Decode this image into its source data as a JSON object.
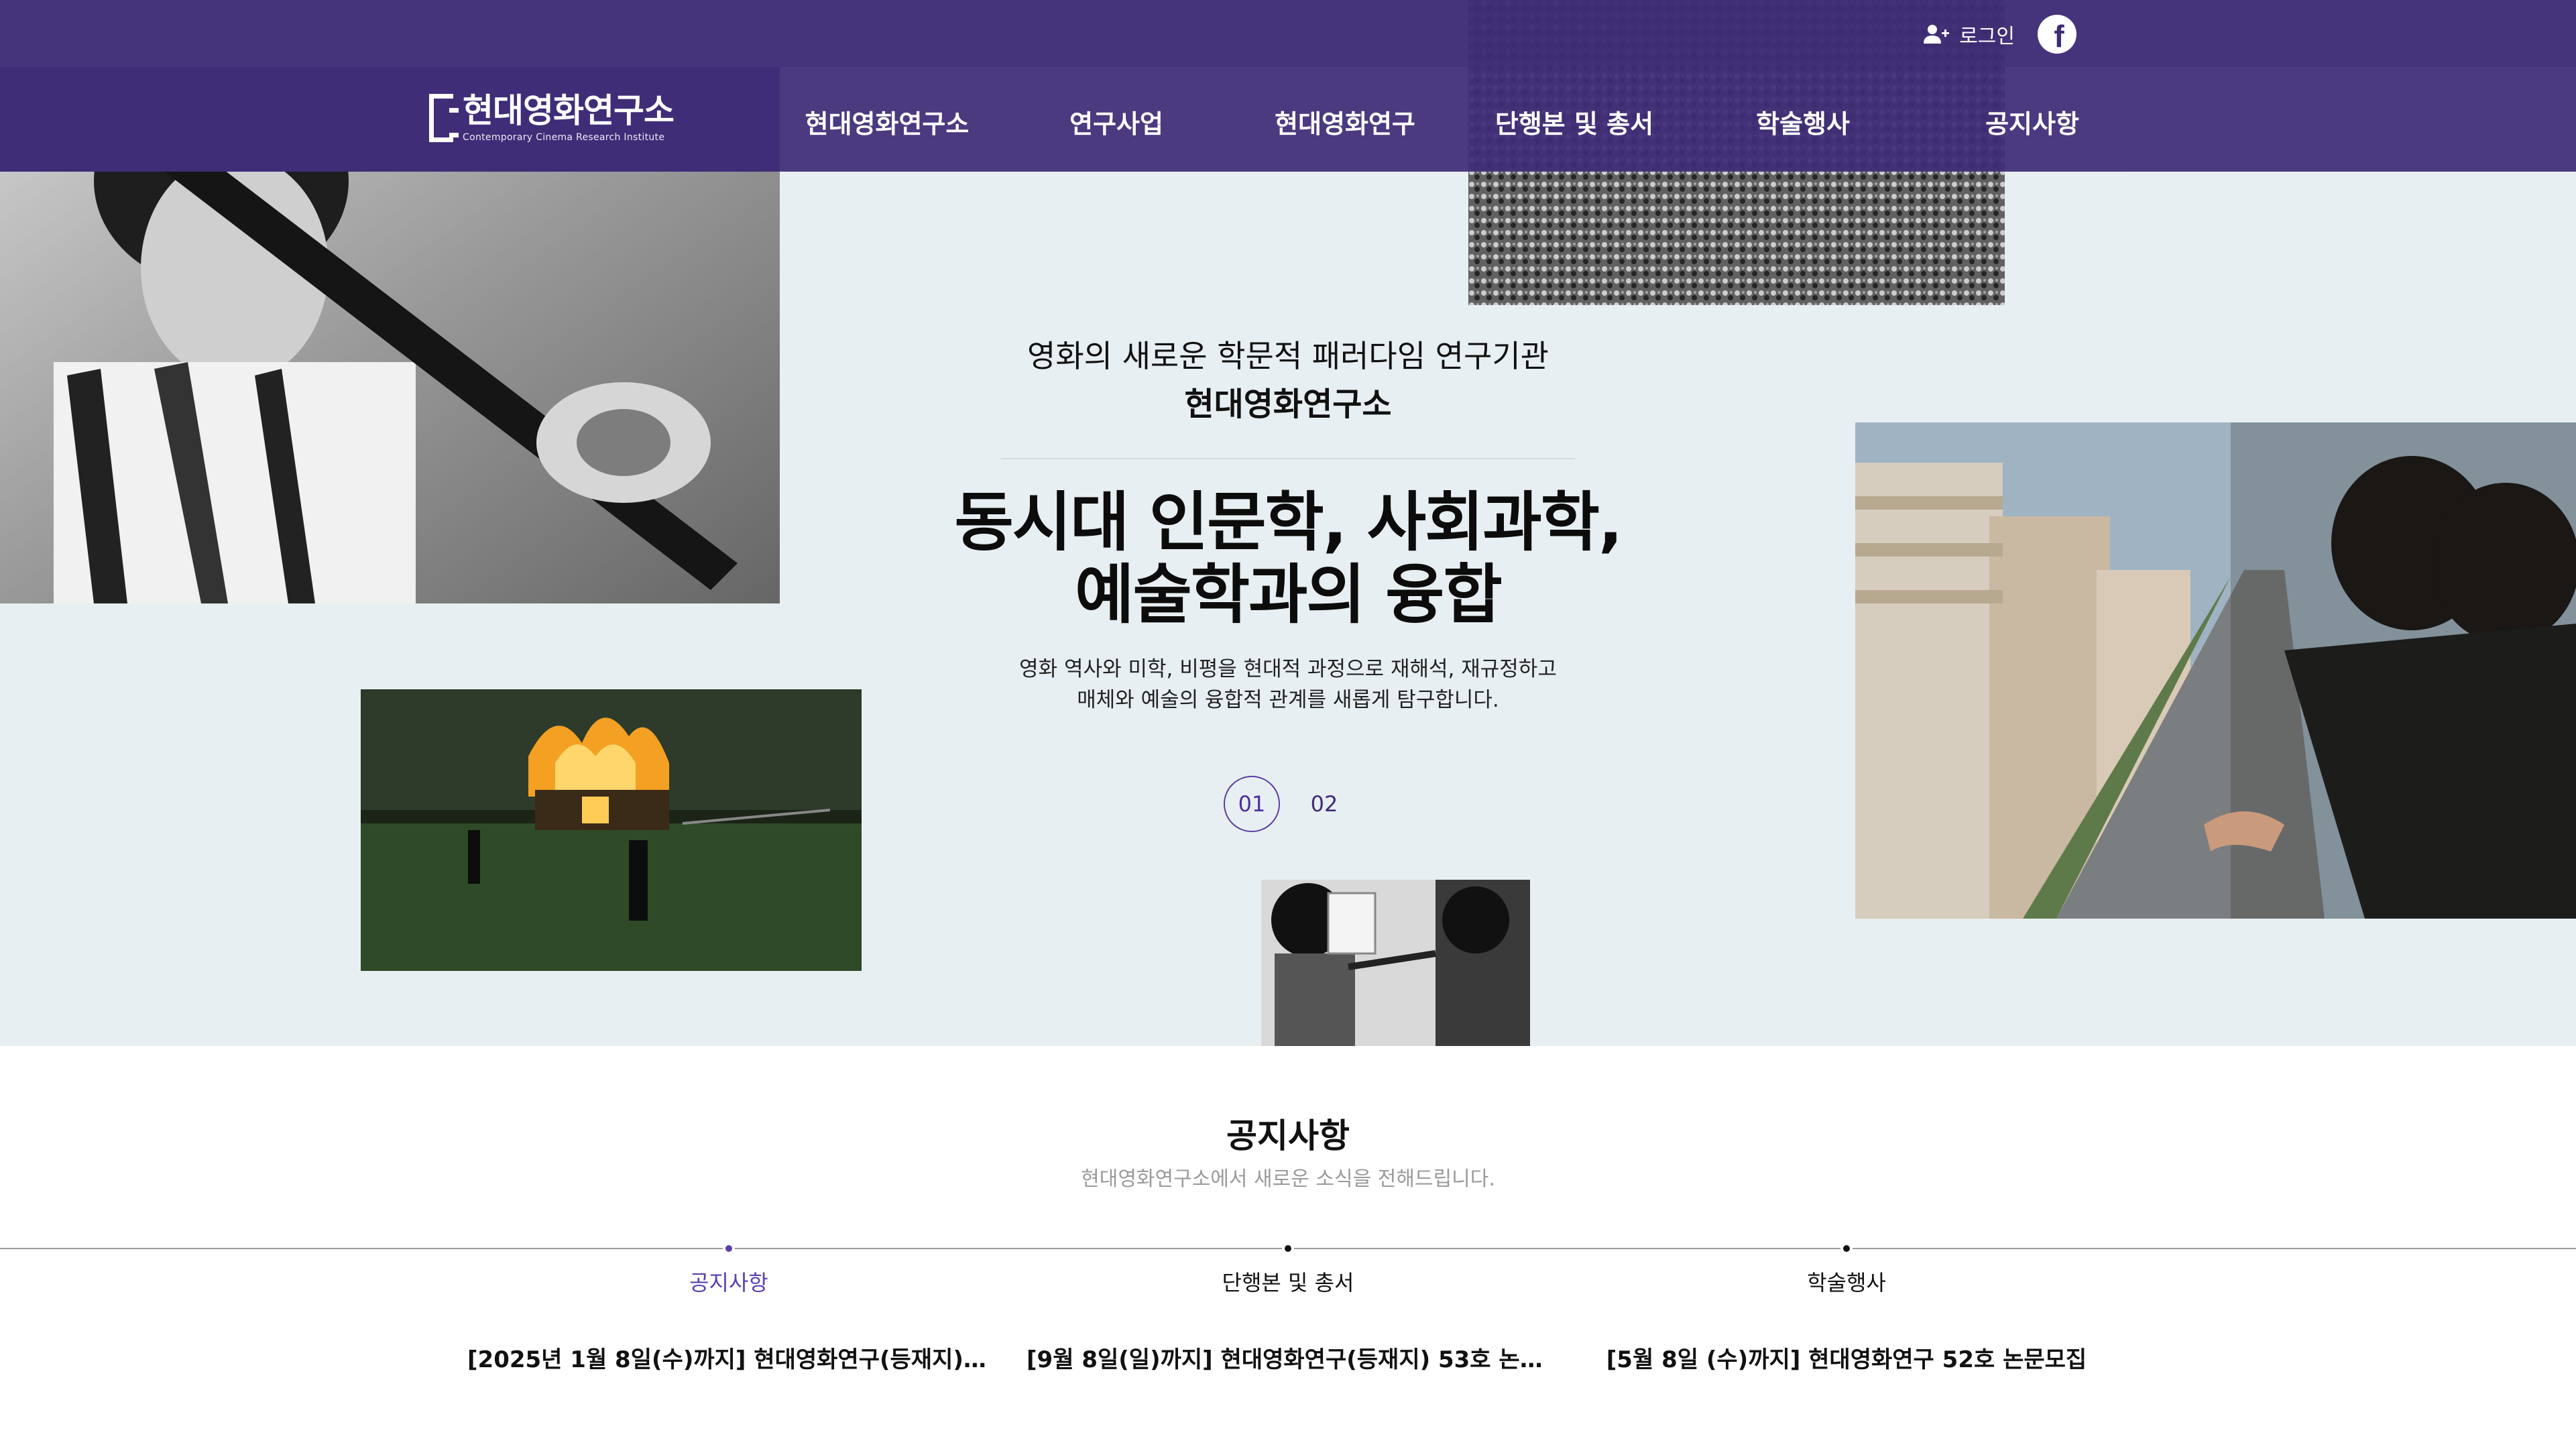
{
  "header": {
    "logo": {
      "title": "현대영화연구소",
      "subtitle": "Contemporary Cinema Research Institute"
    },
    "login_label": "로그인",
    "login_icon": "user-plus-icon",
    "social_icon": "facebook-icon",
    "nav": [
      {
        "label": "현대영화연구소"
      },
      {
        "label": "연구사업"
      },
      {
        "label": "현대영화연구"
      },
      {
        "label": "단행본 및 총서"
      },
      {
        "label": "학술행사"
      },
      {
        "label": "공지사항"
      }
    ],
    "colors": {
      "primary": "#3e2c76",
      "accent": "#5b3fb0"
    }
  },
  "hero": {
    "kicker": "영화의 새로운 학문적 패러다임 연구기관",
    "kicker_strong": "현대영화연구소",
    "headline_line1": "동시대 인문학, 사회과학,",
    "headline_line2": "예술학과의 융합",
    "desc_line1": "영화 역사와 미학, 비평을 현대적 과정으로 재해석, 재규정하고",
    "desc_line2": "매체와 예술의 융합적 관계를 새롭게 탐구합니다.",
    "pager": [
      "01",
      "02"
    ],
    "active_slide": "01",
    "background": "#e8eff2"
  },
  "notice": {
    "title": "공지사항",
    "subtitle": "현대영화연구소에서 새로운 소식을 전해드립니다.",
    "categories": [
      {
        "label": "공지사항",
        "active": true
      },
      {
        "label": "단행본 및 총서",
        "active": false
      },
      {
        "label": "학술행사",
        "active": false
      }
    ],
    "posts": [
      {
        "title": "[2025년 1월 8일(수)까지] 현대영화연구(등재지) 5…"
      },
      {
        "title": "[9월 8일(일)까지] 현대영화연구(등재지) 53호 논문…"
      },
      {
        "title": "[5월 8일 (수)까지] 현대영화연구 52호 논문모집"
      }
    ]
  }
}
